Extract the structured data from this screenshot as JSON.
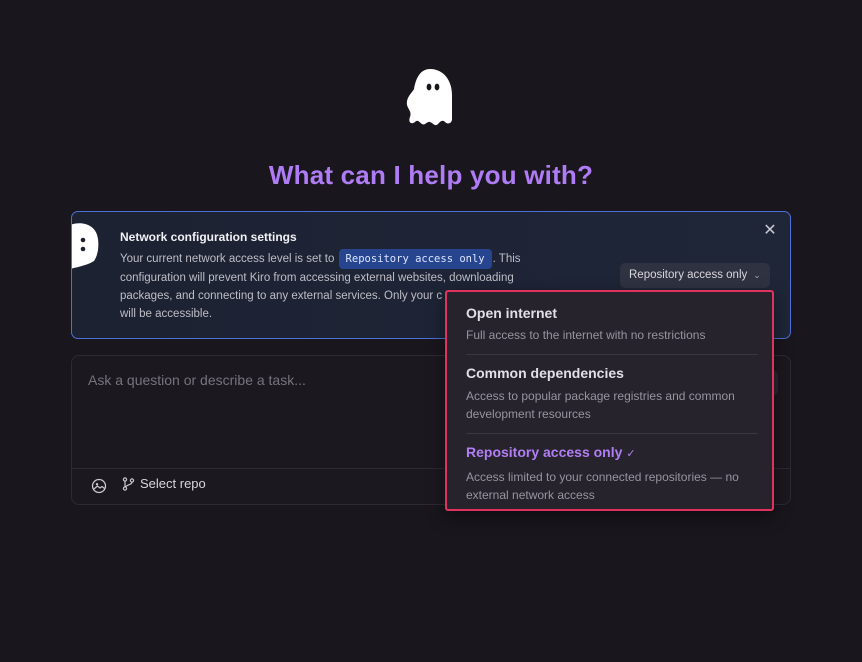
{
  "headline": "What can I help you with?",
  "banner": {
    "title": "Network configuration settings",
    "body_prefix": "Your current network access level is set to ",
    "current_level": "Repository access only",
    "body_line1_end": ". This",
    "body_line2": "configuration will prevent Kiro from accessing external websites, downloading",
    "body_line3": "packages, and connecting to any external services. Only your c",
    "body_line4": "will be accessible.",
    "close_icon": "close-icon",
    "select_value": "Repository access only"
  },
  "chat": {
    "placeholder": "Ask a question or describe a task...",
    "select_repo_label": "Select repo"
  },
  "dropdown": {
    "options": [
      {
        "label": "Open internet",
        "description": "Full access to the internet with no restrictions",
        "selected": false
      },
      {
        "label": "Common dependencies",
        "description": "Access to popular package registries and common development resources",
        "selected": false
      },
      {
        "label": "Repository access only",
        "description": "Access limited to your connected repositories — no external network access",
        "selected": true
      }
    ]
  },
  "colors": {
    "accent": "#b07cf5",
    "banner_border": "#4d6fd6",
    "highlight_border": "#e0325e",
    "background": "#19161d"
  }
}
